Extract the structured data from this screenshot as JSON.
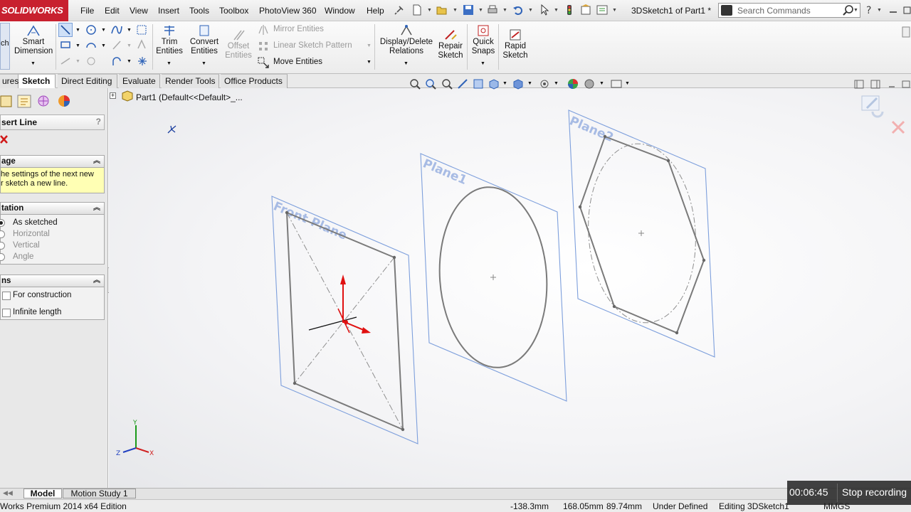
{
  "app": {
    "logo": "SOLIDWORKS",
    "menus": [
      "File",
      "Edit",
      "View",
      "Insert",
      "Tools",
      "Toolbox",
      "PhotoView 360",
      "Window",
      "Help"
    ],
    "document_title": "3DSketch1 of Part1 *",
    "search_placeholder": "Search Commands"
  },
  "ribbon": {
    "cut_label": "ch",
    "smart_dimension": "Smart\nDimension",
    "trim_entities": "Trim\nEntities",
    "convert_entities": "Convert\nEntities",
    "offset_entities": "Offset\nEntities",
    "mirror_entities": "Mirror Entities",
    "linear_sketch_pattern": "Linear Sketch Pattern",
    "move_entities": "Move Entities",
    "display_delete_relations": "Display/Delete\nRelations",
    "repair_sketch": "Repair\nSketch",
    "quick_snaps": "Quick\nSnaps",
    "rapid_sketch": "Rapid\nSketch"
  },
  "tabs": [
    "ures",
    "Sketch",
    "Direct Editing",
    "Evaluate",
    "Render Tools",
    "Office Products"
  ],
  "active_tab": "Sketch",
  "property_manager": {
    "title": "sert Line",
    "help_icon": "?",
    "message_header": "age",
    "message_text": "he settings of the next new\nr sketch a new line.",
    "orientation_header": "tation",
    "orientation_options": [
      "As sketched",
      "Horizontal",
      "Vertical",
      "Angle"
    ],
    "orientation_selected": "As sketched",
    "options_header": "ns",
    "option_for_construction": "For construction",
    "option_infinite_length": "Infinite length"
  },
  "feature_tree": {
    "part_label": "Part1  (Default<<Default>_..."
  },
  "viewport": {
    "plane_labels": [
      "Front Plane",
      "Plane1",
      "Plane2"
    ],
    "accent_blue": "#6f94d6",
    "sketch_gray": "#7a7a7a",
    "axis_red": "#e01010",
    "triad_labels": {
      "x": "X",
      "y": "Y",
      "z": "Z"
    }
  },
  "bottom_tabs": [
    "Model",
    "Motion Study 1"
  ],
  "status": {
    "edition": "Works Premium 2014 x64 Edition",
    "coord_x": "-138.3mm",
    "coord_y": "168.05mm",
    "coord_z": "89.74mm",
    "sketch_state": "Under Defined",
    "editing": "Editing 3DSketch1",
    "units": "MMGS"
  },
  "recorder": {
    "time": "00:06:45",
    "stop_label": "Stop recording"
  }
}
